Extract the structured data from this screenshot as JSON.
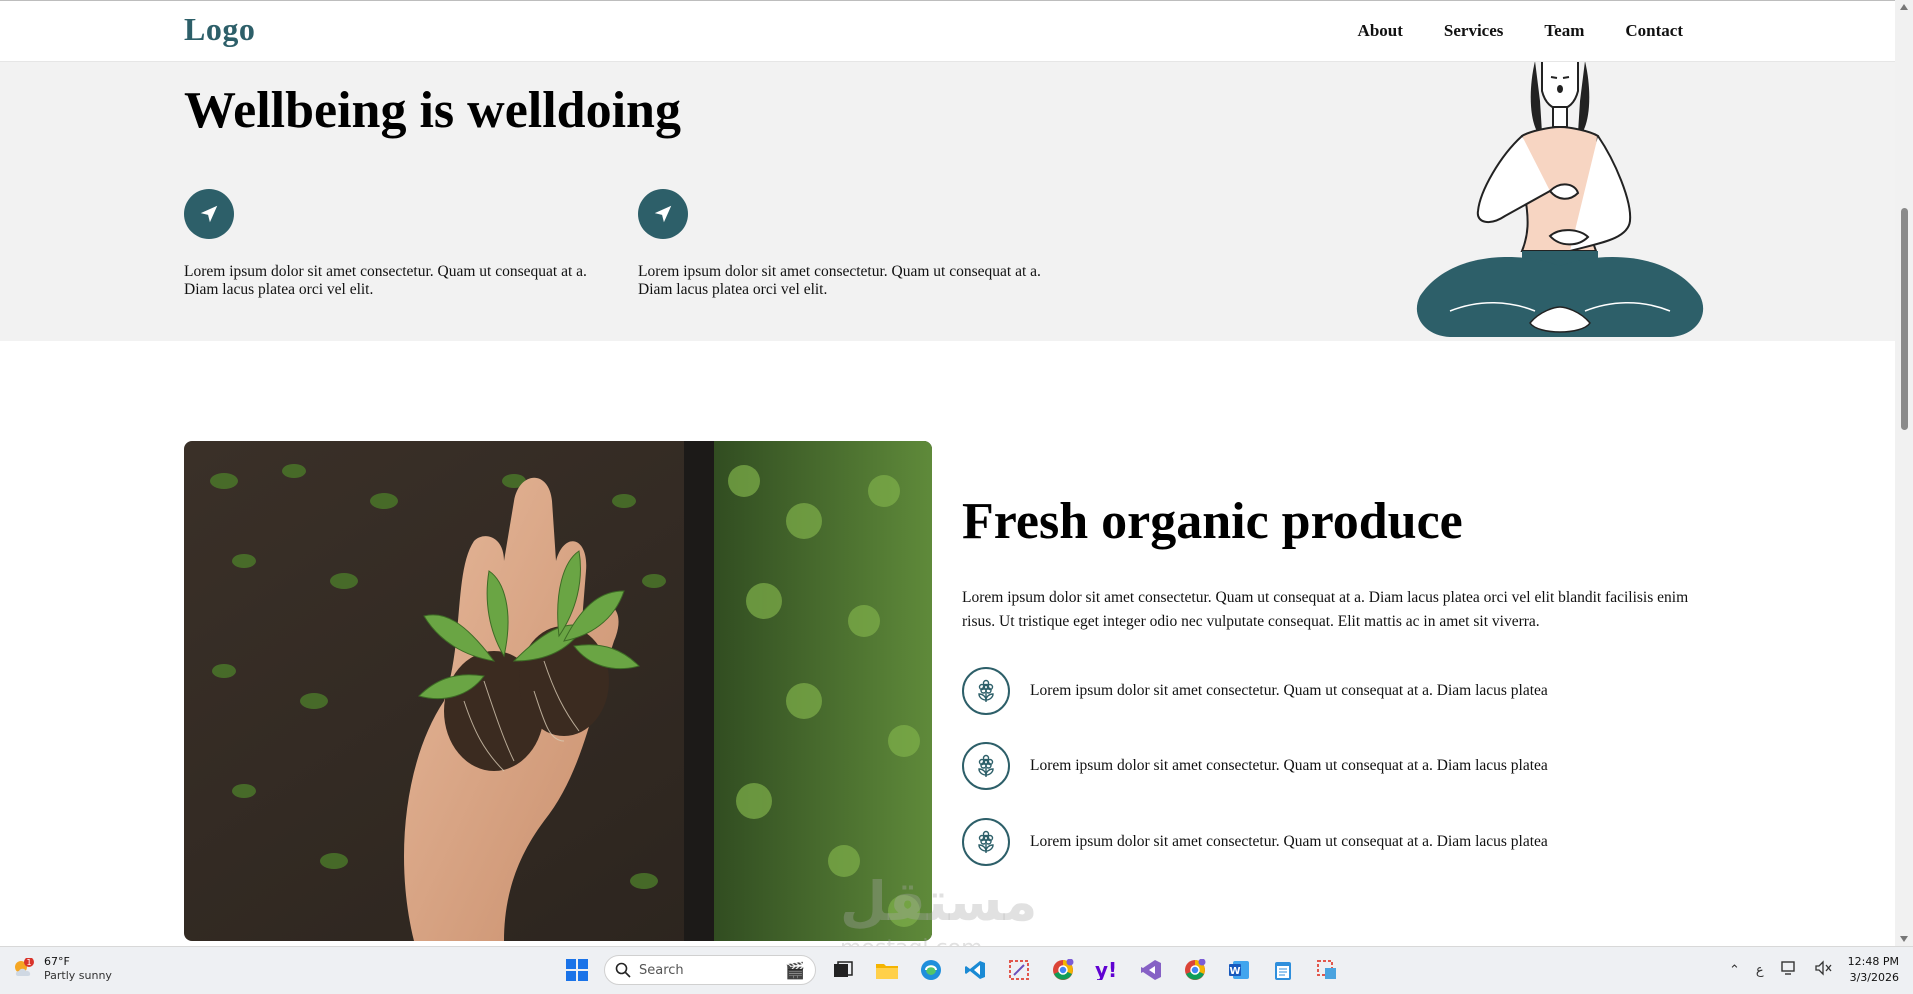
{
  "header": {
    "logo": "Logo",
    "nav": [
      "About",
      "Services",
      "Team",
      "Contact"
    ]
  },
  "hero": {
    "title": "Wellbeing is welldoing",
    "features": [
      {
        "text": "Lorem ipsum dolor sit amet consectetur. Quam ut consequat at a. Diam lacus platea orci vel elit.",
        "icon": "paper-plane-icon"
      },
      {
        "text": "Lorem ipsum dolor sit amet consectetur. Quam ut consequat at a. Diam lacus platea orci vel elit.",
        "icon": "paper-plane-icon"
      }
    ],
    "illustration": "meditating-woman-illustration"
  },
  "section": {
    "title": "Fresh organic produce",
    "paragraph": "Lorem ipsum dolor sit amet consectetur. Quam ut consequat at a. Diam lacus platea orci vel elit blandit facilisis enim risus. Ut tristique eget integer odio nec vulputate consequat. Elit mattis ac in amet sit viverra.",
    "items": [
      {
        "text": "Lorem ipsum dolor sit amet consectetur. Quam ut consequat at a. Diam lacus platea",
        "icon": "flower-icon"
      },
      {
        "text": "Lorem ipsum dolor sit amet consectetur. Quam ut consequat at a. Diam lacus platea",
        "icon": "flower-icon"
      },
      {
        "text": "Lorem ipsum dolor sit amet consectetur. Quam ut consequat at a. Diam lacus platea",
        "icon": "flower-icon"
      }
    ],
    "image": "hand-holding-seedlings-photo"
  },
  "watermark": {
    "main": "مستقل",
    "sub": "mostaql.com"
  },
  "taskbar": {
    "weather_temp": "67°F",
    "weather_condition": "Partly sunny",
    "weather_badge": "1",
    "search_label": "Search",
    "time": "12:48 PM",
    "date": "3/3/2026",
    "lang": "ع"
  },
  "colors": {
    "accent": "#2d5f69",
    "hero_bg": "#f2f2f2",
    "skin_top": "#f7d5c2"
  }
}
